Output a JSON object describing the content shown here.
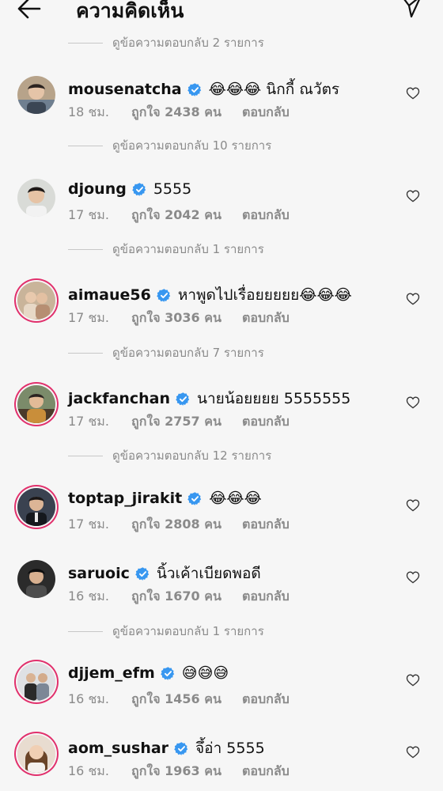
{
  "header": {
    "title": "ความคิดเห็น"
  },
  "replies_rows": [
    {
      "label": "ดูข้อความตอบกลับ 2 รายการ"
    },
    {
      "label": "ดูข้อความตอบกลับ 10 รายการ"
    },
    {
      "label": "ดูข้อความตอบกลับ 1 รายการ"
    },
    {
      "label": "ดูข้อความตอบกลับ 7 รายการ"
    },
    {
      "label": "ดูข้อความตอบกลับ 12 รายการ"
    },
    {
      "label": "ดูข้อความตอบกลับ 1 รายการ"
    }
  ],
  "comments": [
    {
      "username": "mousenatcha",
      "text": "😂😂😂 นิกกี้ ณวัตร",
      "time": "18 ชม.",
      "likes": "ถูกใจ 2438 คน",
      "reply": "ตอบกลับ"
    },
    {
      "username": "djoung",
      "text": "5555",
      "time": "17 ชม.",
      "likes": "ถูกใจ 2042 คน",
      "reply": "ตอบกลับ"
    },
    {
      "username": "aimaue56",
      "text": "หาพูดไปเรื่อยยยยย😂😂😂",
      "time": "17 ชม.",
      "likes": "ถูกใจ 3036 คน",
      "reply": "ตอบกลับ"
    },
    {
      "username": "jackfanchan",
      "text": "นายน้อยยยย 5555555",
      "time": "17 ชม.",
      "likes": "ถูกใจ 2757 คน",
      "reply": "ตอบกลับ"
    },
    {
      "username": "toptap_jirakit",
      "text": "😂😂😂",
      "time": "17 ชม.",
      "likes": "ถูกใจ 2808 คน",
      "reply": "ตอบกลับ"
    },
    {
      "username": "saruoic",
      "text": "นิ้วเค้าเบียดพอดี",
      "time": "16 ชม.",
      "likes": "ถูกใจ 1670 คน",
      "reply": "ตอบกลับ"
    },
    {
      "username": "djjem_efm",
      "text": "😅😅😅",
      "time": "16 ชม.",
      "likes": "ถูกใจ 1456 คน",
      "reply": "ตอบกลับ"
    },
    {
      "username": "aom_sushar",
      "text": "จึ้อ่า 5555",
      "time": "16 ชม.",
      "likes": "ถูกใจ 1963 คน",
      "reply": "ตอบกลับ"
    }
  ]
}
